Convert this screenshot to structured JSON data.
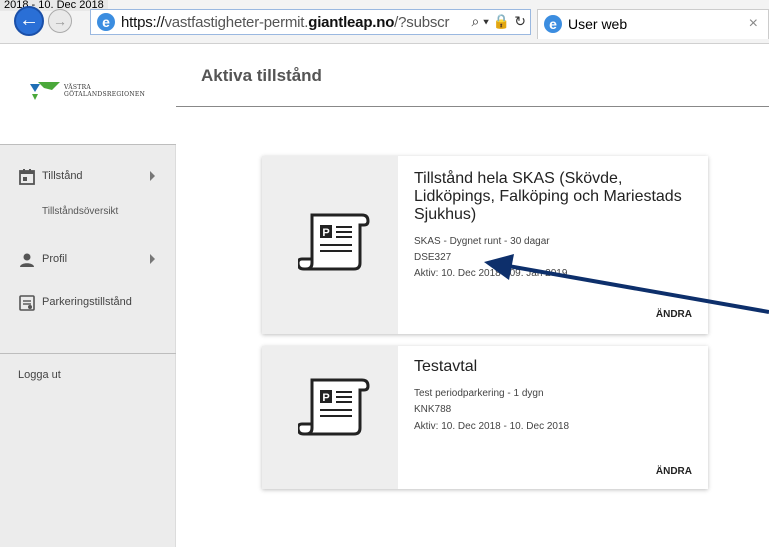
{
  "window": {
    "top_tab_text": "2018 - 10. Dec 2018"
  },
  "browser": {
    "url_protocol": "https://",
    "url_prefix": "vastfastigheter-permit.",
    "url_domain": "giantleap.no",
    "url_rest": "/?subscr",
    "tab_title": "User web",
    "tab_close": "×",
    "tools": "⌕ ▾ 🔒 ↻"
  },
  "logo": {
    "line1": "VÄSTRA",
    "line2": "GÖTALANDSREGIONEN"
  },
  "sidebar": {
    "items": [
      {
        "label": "Tillstånd",
        "icon": "calendar-icon"
      },
      {
        "label": "Tillståndsöversikt"
      },
      {
        "label": "Profil",
        "icon": "person-icon"
      },
      {
        "label": "Parkeringstillstånd",
        "icon": "permit-doc-icon"
      }
    ],
    "logout": "Logga ut"
  },
  "page": {
    "title": "Aktiva tillstånd"
  },
  "cards": [
    {
      "title": "Tillstånd hela SKAS (Skövde, Lidköpings, Falköping och Mariestads Sjukhus)",
      "subtitle": "SKAS - Dygnet runt - 30 dagar",
      "plate": "DSE327",
      "active": "Aktiv: 10. Dec 2018 - 09. Jan 2019",
      "action": "ÄNDRA"
    },
    {
      "title": "Testavtal",
      "subtitle": "Test periodparkering - 1 dygn",
      "plate": "KNK788",
      "active": "Aktiv: 10. Dec 2018 - 10. Dec 2018",
      "action": "ÄNDRA"
    }
  ],
  "colors": {
    "arrow": "#0d2f6b",
    "ie_blue": "#2a6fd6",
    "logo_green": "#4aa83a",
    "logo_blue": "#1f6fb5"
  }
}
